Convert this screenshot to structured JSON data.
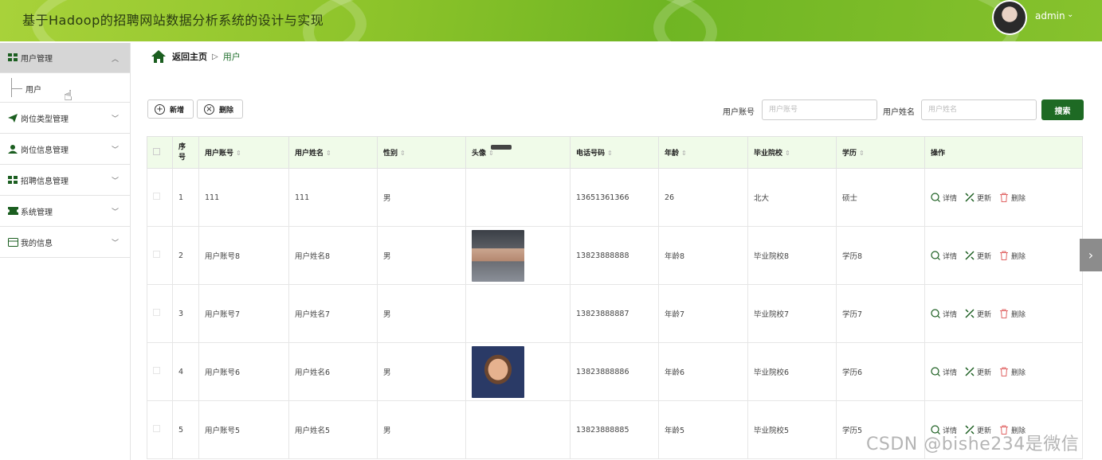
{
  "header": {
    "title": "基于Hadoop的招聘网站数据分析系统的设计与实现",
    "user_name": "admin",
    "caret": "⌄"
  },
  "sidebar": {
    "items": [
      {
        "label": "用户管理",
        "icon": "grid-icon",
        "expanded": true
      },
      {
        "label": "岗位类型管理",
        "icon": "paper-plane-icon"
      },
      {
        "label": "岗位信息管理",
        "icon": "person-icon"
      },
      {
        "label": "招聘信息管理",
        "icon": "grid-icon"
      },
      {
        "label": "系统管理",
        "icon": "ticket-icon"
      },
      {
        "label": "我的信息",
        "icon": "id-card-icon"
      }
    ],
    "subitem": "用户"
  },
  "breadcrumb": {
    "home": "返回主页",
    "separator": "▷",
    "current": "用户"
  },
  "toolbar": {
    "add_label": "新增",
    "delete_label": "删除",
    "search_account_label": "用户账号",
    "search_account_placeholder": "用户账号",
    "search_name_label": "用户姓名",
    "search_name_placeholder": "用户姓名",
    "search_button": "搜索"
  },
  "table": {
    "columns": [
      "序号",
      "用户账号",
      "用户姓名",
      "性别",
      "头像",
      "电话号码",
      "年龄",
      "毕业院校",
      "学历",
      "操作"
    ],
    "rows": [
      {
        "index": "1",
        "account": "111",
        "name": "111",
        "gender": "男",
        "avatar": "partial",
        "phone": "13651361366",
        "age": "26",
        "school": "北大",
        "degree": "硕士"
      },
      {
        "index": "2",
        "account": "用户账号8",
        "name": "用户姓名8",
        "gender": "男",
        "avatar": "photo-1",
        "phone": "13823888888",
        "age": "年龄8",
        "school": "毕业院校8",
        "degree": "学历8"
      },
      {
        "index": "3",
        "account": "用户账号7",
        "name": "用户姓名7",
        "gender": "男",
        "avatar": "none",
        "phone": "13823888887",
        "age": "年龄7",
        "school": "毕业院校7",
        "degree": "学历7"
      },
      {
        "index": "4",
        "account": "用户账号6",
        "name": "用户姓名6",
        "gender": "男",
        "avatar": "photo-2",
        "phone": "13823888886",
        "age": "年龄6",
        "school": "毕业院校6",
        "degree": "学历6"
      },
      {
        "index": "5",
        "account": "用户账号5",
        "name": "用户姓名5",
        "gender": "男",
        "avatar": "none",
        "phone": "13823888885",
        "age": "年龄5",
        "school": "毕业院校5",
        "degree": "学历5"
      }
    ],
    "actions": {
      "detail": "详情",
      "update": "更新",
      "delete": "删除"
    }
  },
  "watermark": "CSDN @bishe234是微信",
  "colors": {
    "accent": "#1e6a24",
    "header": "#8cc32a",
    "table_header": "#f0fbe9"
  }
}
